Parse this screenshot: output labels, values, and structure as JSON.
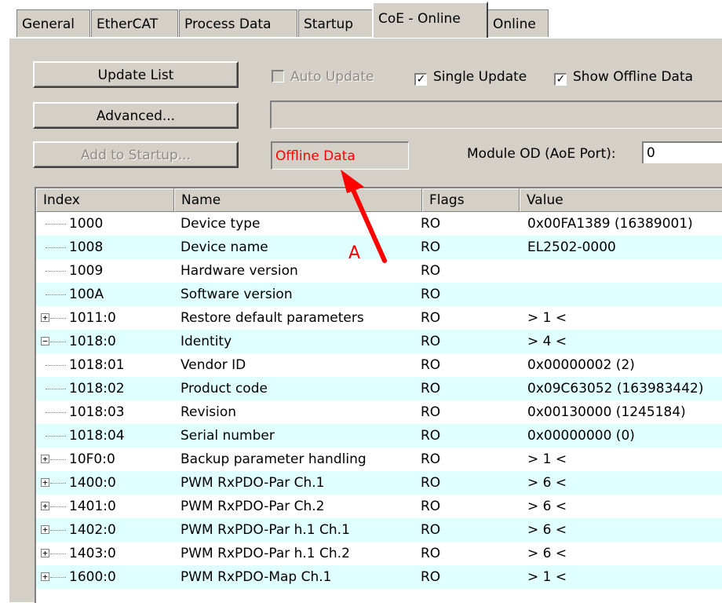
{
  "tabs": [
    {
      "label": "General"
    },
    {
      "label": "EtherCAT"
    },
    {
      "label": "Process Data"
    },
    {
      "label": "Startup"
    },
    {
      "label": "CoE - Online"
    },
    {
      "label": "Online"
    }
  ],
  "buttons": {
    "update_list": "Update List",
    "advanced": "Advanced...",
    "add_to_startup": "Add to Startup..."
  },
  "checkboxes": {
    "auto_update": {
      "label": "Auto Update",
      "checked": false
    },
    "single_update": {
      "label": "Single Update",
      "checked": true
    },
    "show_offline": {
      "label": "Show Offline Data",
      "checked": true
    }
  },
  "status": {
    "offline_data": "Offline Data"
  },
  "module_od": {
    "label": "Module OD (AoE Port):",
    "value": "0"
  },
  "annotation": {
    "label": "A"
  },
  "colors": {
    "panel": "#d4d0c8",
    "alt_row": "#e0ffff",
    "status_text": "#ff0000",
    "arrow": "#ff0000"
  },
  "table": {
    "columns": [
      "Index",
      "Name",
      "Flags",
      "Value"
    ],
    "rows": [
      {
        "index": "1000",
        "name": "Device type",
        "flags": "RO",
        "value": "0x00FA1389 (16389001)"
      },
      {
        "index": "1008",
        "name": "Device name",
        "flags": "RO",
        "value": "EL2502-0000"
      },
      {
        "index": "1009",
        "name": "Hardware version",
        "flags": "RO",
        "value": ""
      },
      {
        "index": "100A",
        "name": "Software version",
        "flags": "RO",
        "value": ""
      },
      {
        "index": "1011:0",
        "name": "Restore default parameters",
        "flags": "RO",
        "value": "> 1 <"
      },
      {
        "index": "1018:0",
        "name": "Identity",
        "flags": "RO",
        "value": "> 4 <"
      },
      {
        "index": "1018:01",
        "name": "Vendor ID",
        "flags": "RO",
        "value": "0x00000002 (2)"
      },
      {
        "index": "1018:02",
        "name": "Product code",
        "flags": "RO",
        "value": "0x09C63052 (163983442)"
      },
      {
        "index": "1018:03",
        "name": "Revision",
        "flags": "RO",
        "value": "0x00130000 (1245184)"
      },
      {
        "index": "1018:04",
        "name": "Serial number",
        "flags": "RO",
        "value": "0x00000000 (0)"
      },
      {
        "index": "10F0:0",
        "name": "Backup parameter handling",
        "flags": "RO",
        "value": "> 1 <"
      },
      {
        "index": "1400:0",
        "name": "PWM RxPDO-Par Ch.1",
        "flags": "RO",
        "value": "> 6 <"
      },
      {
        "index": "1401:0",
        "name": "PWM RxPDO-Par Ch.2",
        "flags": "RO",
        "value": "> 6 <"
      },
      {
        "index": "1402:0",
        "name": "PWM RxPDO-Par h.1 Ch.1",
        "flags": "RO",
        "value": "> 6 <"
      },
      {
        "index": "1403:0",
        "name": "PWM RxPDO-Par h.1 Ch.2",
        "flags": "RO",
        "value": "> 6 <"
      },
      {
        "index": "1600:0",
        "name": "PWM RxPDO-Map Ch.1",
        "flags": "RO",
        "value": "> 1 <"
      }
    ]
  }
}
